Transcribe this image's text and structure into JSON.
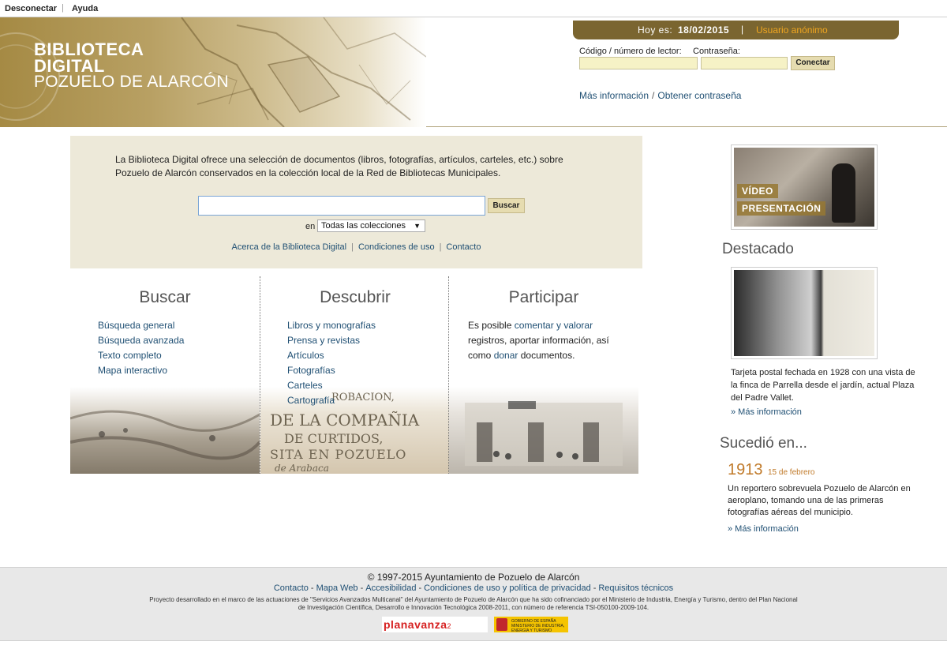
{
  "topbar": {
    "logout": "Desconectar",
    "help": "Ayuda",
    "separator": "|"
  },
  "banner": {
    "line1": "BIBLIOTECA",
    "line2": "DIGITAL",
    "line3": "POZUELO DE ALARCÓN"
  },
  "datebar": {
    "today_label": "Hoy es:",
    "date": "18/02/2015",
    "separator": "|",
    "user": "Usuario anónimo"
  },
  "login": {
    "code_label": "Código / número de lector:",
    "password_label": "Contraseña:",
    "code_value": "",
    "password_value": "",
    "button": "Conectar",
    "more_info": "Más información",
    "slash": "/",
    "get_password": "Obtener contraseña"
  },
  "intro": {
    "text": "La Biblioteca Digital ofrece una selección de documentos (libros, fotografías, artículos, carteles, etc.) sobre Pozuelo de Alarcón conservados en la colección local de la Red de Bibliotecas Municipales.",
    "search_value": "",
    "search_button": "Buscar",
    "in_label": "en",
    "collection_selected": "Todas las colecciones",
    "links": [
      "Acerca de la Biblioteca Digital",
      "Condiciones de uso",
      "Contacto"
    ],
    "link_sep": "|"
  },
  "columns": {
    "buscar": {
      "title": "Buscar",
      "items": [
        "Búsqueda general",
        "Búsqueda avanzada",
        "Texto completo",
        "Mapa interactivo"
      ]
    },
    "descubrir": {
      "title": "Descubrir",
      "items": [
        "Libros y monografías",
        "Prensa y revistas",
        "Artículos",
        "Fotografías",
        "Carteles",
        "Cartografía"
      ],
      "photo_text": [
        "ROBACION,",
        "DE LA COMPAÑIA",
        "DE CURTIDOS,",
        "SITA EN POZUELO",
        "de Arabaca"
      ]
    },
    "participar": {
      "title": "Participar",
      "text_before": "Es posible ",
      "link1": "comentar y valorar",
      "text_mid": " registros, aportar información, así como ",
      "link2": "donar",
      "text_after": " documentos."
    }
  },
  "video": {
    "tag1": "VÍDEO",
    "tag2": "PRESENTACIÓN"
  },
  "destacado": {
    "title": "Destacado",
    "text": "Tarjeta postal fechada en 1928 con una vista de la finca de Parrella desde el jardín, actual Plaza del Padre Vallet.",
    "more": "» Más información"
  },
  "sucedio": {
    "title": "Sucedió en...",
    "year": "1913",
    "date": "15 de febrero",
    "text": "Un reportero sobrevuela Pozuelo de Alarcón en aeroplano, tomando una de las primeras fotografías aéreas del municipio.",
    "more": "» Más información"
  },
  "footer": {
    "copyright": "© 1997-2015 Ayuntamiento de Pozuelo de Alarcón",
    "links": [
      "Contacto",
      "Mapa Web",
      "Accesibilidad",
      "Condiciones de uso y política de privacidad",
      "Requisitos técnicos"
    ],
    "link_sep": "-",
    "project": "Proyecto desarrollado en el marco de las actuaciones de \"Servicios Avanzados Multicanal\" del Ayuntamiento de Pozuelo de Alarcón que ha sido cofinanciado por el Ministerio de Industria, Energía y Turismo, dentro del Plan Nacional de Investigación Científica, Desarrollo e Innovación Tecnológica 2008-2011, con número de referencia TSI-050100-2009-104.",
    "logo_plan": "planavanza",
    "logo_plan_suffix": "2",
    "logo_gob": [
      "GOBIERNO DE ESPAÑA",
      "MINISTERIO DE INDUSTRIA, ENERGÍA Y TURISMO"
    ]
  },
  "colors": {
    "gold": "#7a6530",
    "accent_orange": "#c07a2a",
    "link_blue": "#1f4f73",
    "panel_beige": "#ede9d9"
  }
}
